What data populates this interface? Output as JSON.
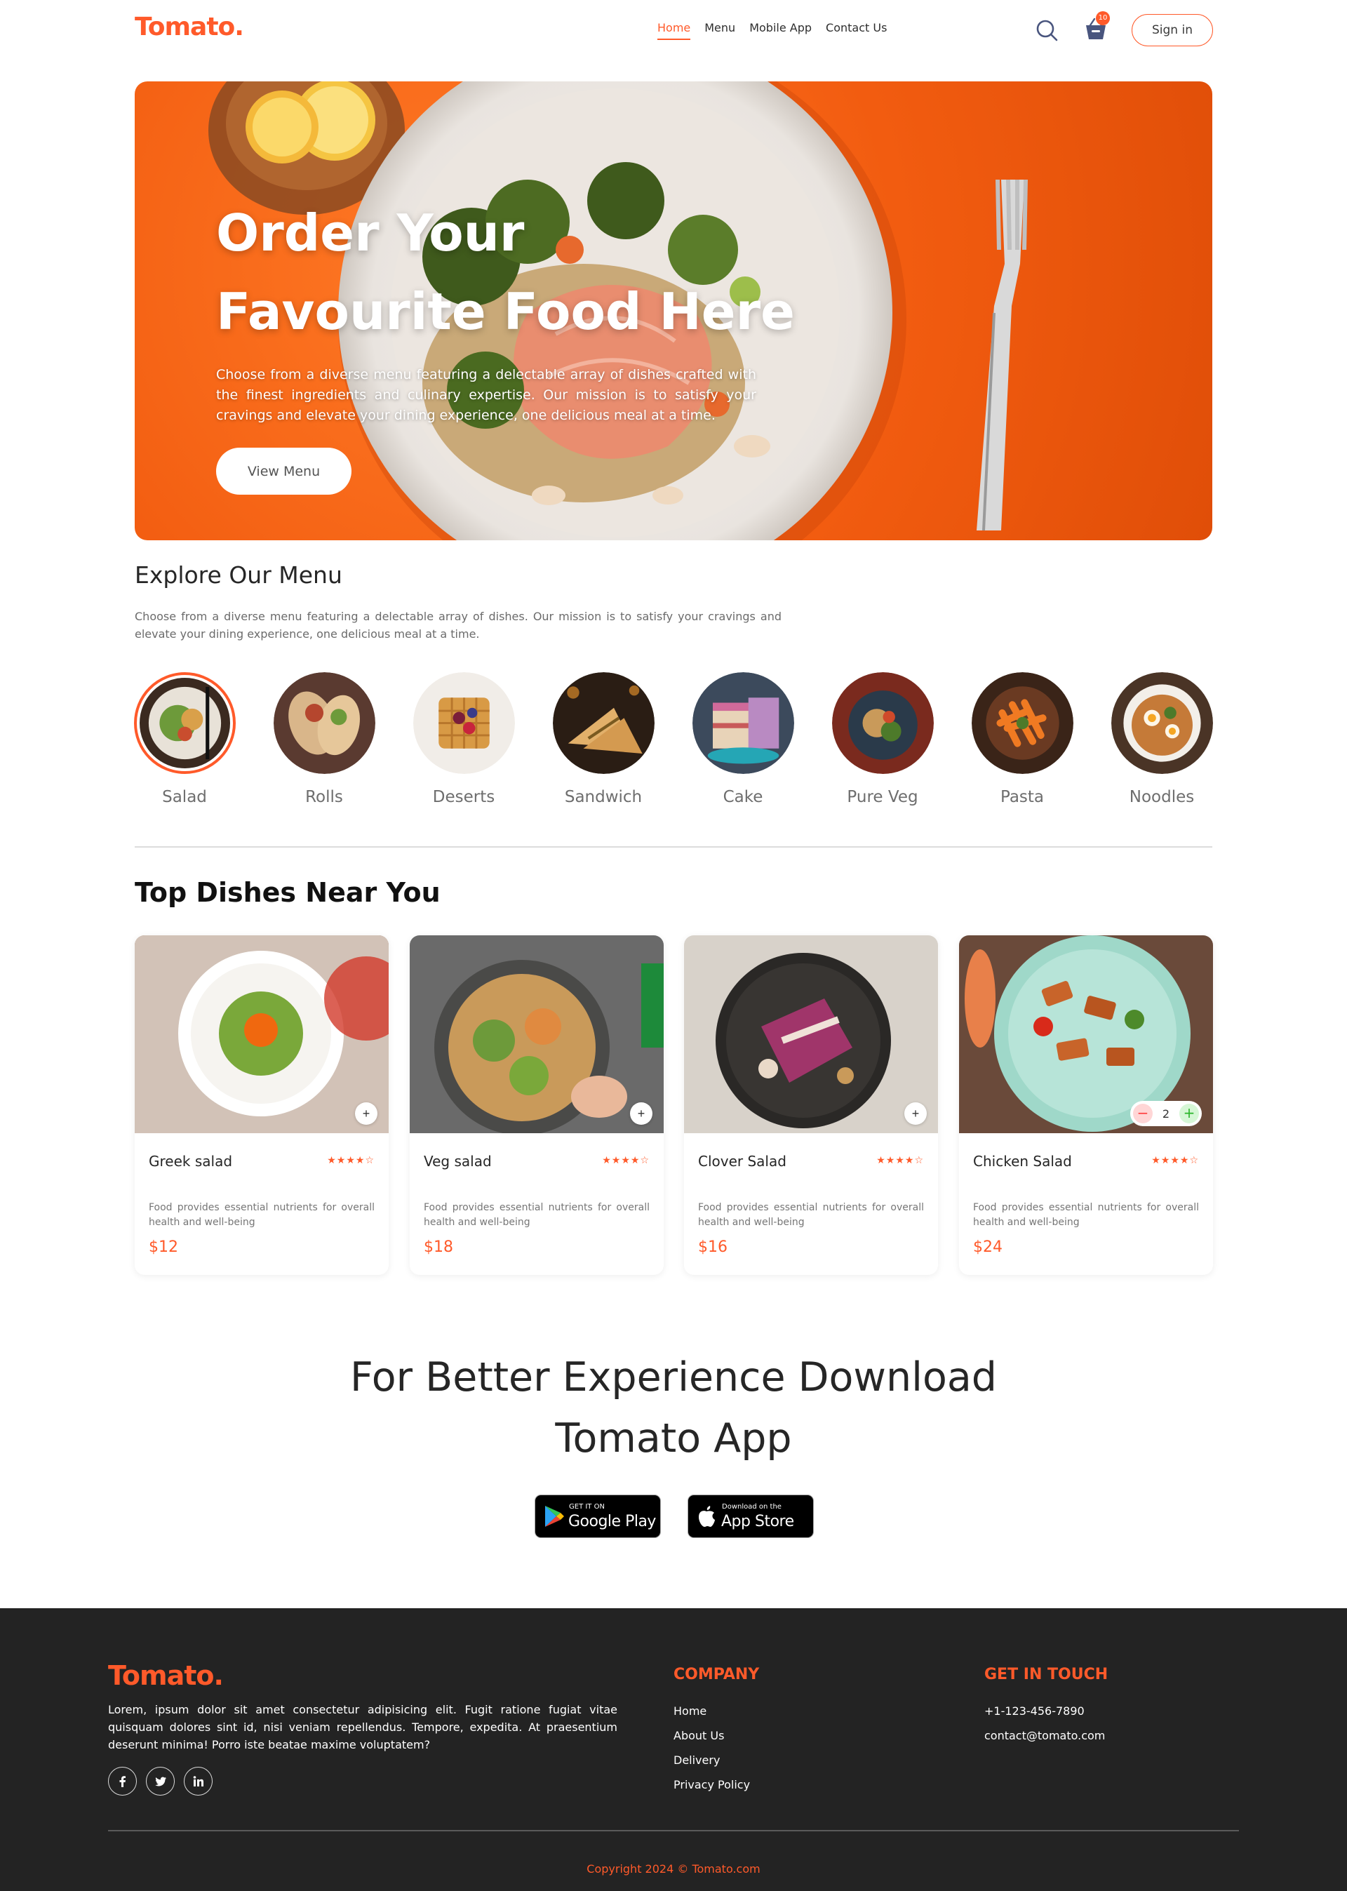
{
  "brand": {
    "logo": "Tomato.",
    "accent_color": "#ff5a2a"
  },
  "nav": {
    "links": [
      {
        "label": "Home",
        "active": true
      },
      {
        "label": "Menu",
        "active": false
      },
      {
        "label": "Mobile App",
        "active": false
      },
      {
        "label": "Contact Us",
        "active": false
      }
    ],
    "search_icon": "search-icon",
    "basket_icon": "basket-icon",
    "cart_count": "10",
    "signin_label": "Sign in"
  },
  "hero": {
    "title_line1": "Order Your",
    "title_line2": "Favourite Food Here",
    "description": "Choose from a diverse menu featuring a delectable array of dishes crafted with the finest ingredients and culinary expertise. Our mission is to satisfy your cravings and elevate your dining experience, one delicious meal at a time.",
    "button_label": "View Menu"
  },
  "explore": {
    "title": "Explore Our Menu",
    "description": "Choose from a diverse menu featuring a delectable array of dishes. Our mission is to satisfy your cravings and elevate your dining experience, one delicious meal at a time.",
    "items": [
      {
        "label": "Salad",
        "selected": true
      },
      {
        "label": "Rolls",
        "selected": false
      },
      {
        "label": "Deserts",
        "selected": false
      },
      {
        "label": "Sandwich",
        "selected": false
      },
      {
        "label": "Cake",
        "selected": false
      },
      {
        "label": "Pure Veg",
        "selected": false
      },
      {
        "label": "Pasta",
        "selected": false
      },
      {
        "label": "Noodles",
        "selected": false
      }
    ]
  },
  "top_dishes": {
    "title": "Top Dishes Near You",
    "dishes": [
      {
        "name": "Greek salad",
        "rating": "★★★★☆",
        "description": "Food provides essential nutrients for overall health and well-being",
        "price": "$12",
        "in_cart": false
      },
      {
        "name": "Veg salad",
        "rating": "★★★★☆",
        "description": "Food provides essential nutrients for overall health and well-being",
        "price": "$18",
        "in_cart": false
      },
      {
        "name": "Clover Salad",
        "rating": "★★★★☆",
        "description": "Food provides essential nutrients for overall health and well-being",
        "price": "$16",
        "in_cart": false
      },
      {
        "name": "Chicken Salad",
        "rating": "★★★★☆",
        "description": "Food provides essential nutrients for overall health and well-being",
        "price": "$24",
        "in_cart": true,
        "quantity": "2"
      }
    ]
  },
  "app_download": {
    "title_line1": "For Better Experience Download",
    "title_line2": "Tomato App",
    "google_play_small": "GET IT ON",
    "google_play_big": "Google Play",
    "app_store_small": "Download on the",
    "app_store_big": "App Store"
  },
  "footer": {
    "logo": "Tomato.",
    "description": "Lorem, ipsum dolor sit amet consectetur adipisicing elit. Fugit ratione fugiat vitae quisquam dolores sint id, nisi veniam repellendus. Tempore, expedita. At praesentium deserunt minima! Porro iste beatae maxime voluptatem?",
    "social_icons": [
      "facebook-icon",
      "twitter-icon",
      "linkedin-icon"
    ],
    "company_heading": "COMPANY",
    "company_links": [
      "Home",
      "About Us",
      "Delivery",
      "Privacy Policy"
    ],
    "contact_heading": "GET IN TOUCH",
    "phone": "+1-123-456-7890",
    "email": "contact@tomato.com",
    "copyright": "Copyright 2024 © Tomato.com"
  }
}
